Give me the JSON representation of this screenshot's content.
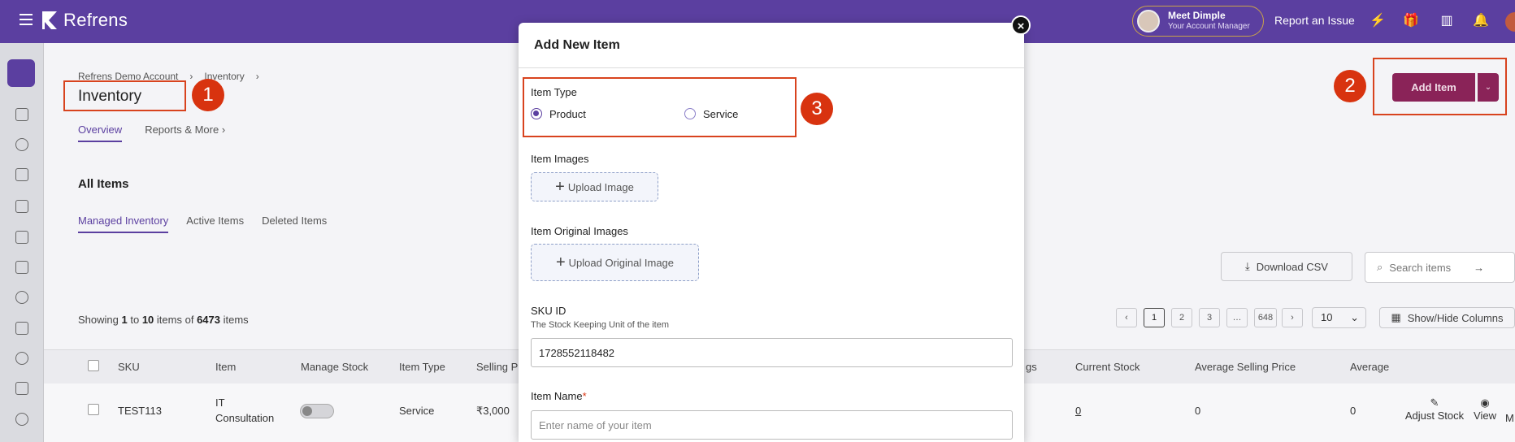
{
  "topbar": {
    "brand": "Refrens",
    "manager_name": "Meet Dimple",
    "manager_role": "Your Account Manager",
    "report_label": "Report an Issue",
    "icons": [
      "lightning-icon",
      "gift-icon",
      "store-icon",
      "bell-icon"
    ]
  },
  "breadcrumb": {
    "items": [
      "Refrens Demo Account",
      "Inventory"
    ]
  },
  "page": {
    "title": "Inventory",
    "tabs": [
      "Overview",
      "Reports & More"
    ],
    "section_title": "All Items",
    "sub_tabs": [
      "Managed Inventory",
      "Active Items",
      "Deleted Items"
    ],
    "showing": {
      "prefix": "Showing",
      "from": "1",
      "to_word": "to",
      "to": "10",
      "items_of": "items of",
      "total": "6473",
      "suffix": "items"
    },
    "download_label": "Download CSV",
    "search_placeholder": "Search items",
    "pages": [
      "1",
      "2",
      "3",
      "…",
      "648"
    ],
    "per_page": "10",
    "show_hide_label": "Show/Hide Columns",
    "add_item_label": "Add Item"
  },
  "table": {
    "headers": [
      "SKU",
      "Item",
      "Manage Stock",
      "Item Type",
      "Selling P",
      "gs",
      "Current Stock",
      "Average Selling Price",
      "Average"
    ],
    "row": {
      "sku": "TEST113",
      "item_line1": "IT",
      "item_line2": "Consultation",
      "item_type": "Service",
      "selling": "₹3,000",
      "current_stock": "0",
      "avg_selling": "0",
      "average": "0",
      "action_adjust": "Adjust Stock",
      "action_view": "View",
      "action_more": "M"
    }
  },
  "modal": {
    "title": "Add New Item",
    "item_type_label": "Item Type",
    "item_type_options": [
      "Product",
      "Service"
    ],
    "item_type_selected": "Product",
    "item_images_label": "Item Images",
    "upload_image_label": "Upload Image",
    "original_images_label": "Item Original Images",
    "upload_original_label": "Upload Original Image",
    "sku_label": "SKU ID",
    "sku_help": "The Stock Keeping Unit of the item",
    "sku_value": "1728552118482",
    "item_name_label": "Item Name",
    "item_name_required": "*",
    "item_name_placeholder": "Enter name of your item"
  },
  "markers": [
    "1",
    "2",
    "3"
  ],
  "colors": {
    "brand": "#5b3fa0",
    "add_button": "#8a2358",
    "highlight": "#d8431e"
  }
}
